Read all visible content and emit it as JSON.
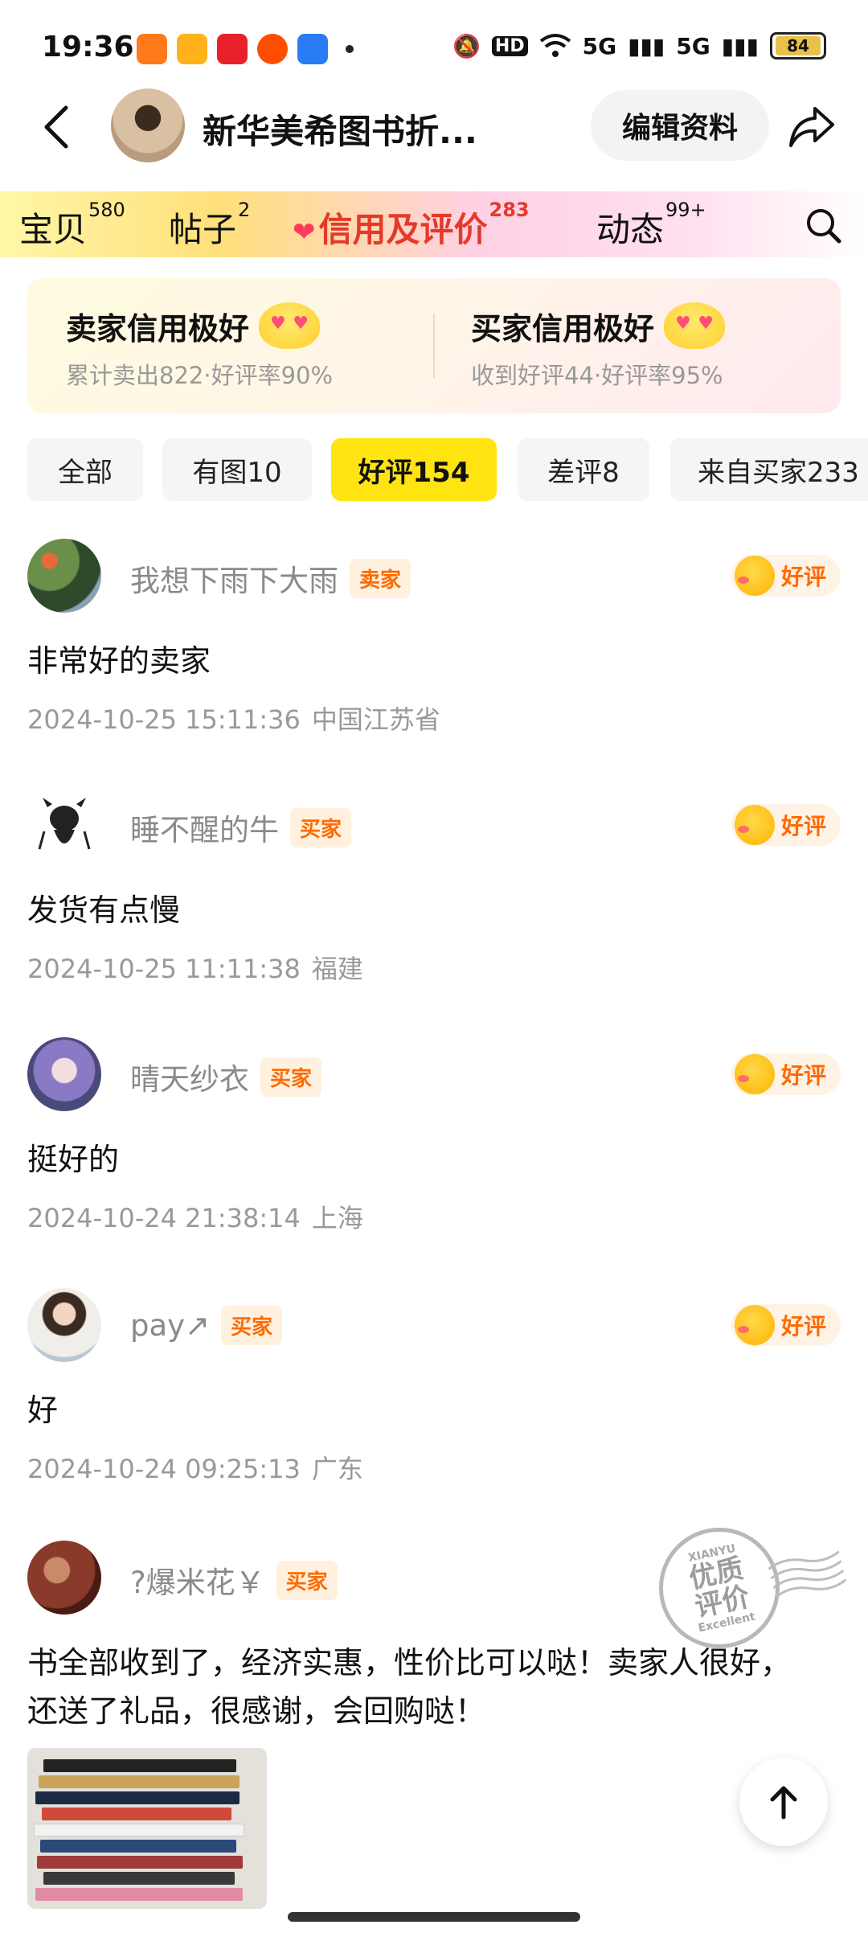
{
  "status_bar": {
    "time": "19:36",
    "battery": "84",
    "network": "5G"
  },
  "header": {
    "shop_name": "新华美希图书折...",
    "edit_button": "编辑资料"
  },
  "tabs": [
    {
      "label": "宝贝",
      "count": "580",
      "active": false
    },
    {
      "label": "帖子",
      "count": "2",
      "active": false
    },
    {
      "label": "信用及评价",
      "count": "283",
      "active": true
    },
    {
      "label": "动态",
      "count": "99+",
      "active": false
    }
  ],
  "credit": {
    "seller": {
      "title": "卖家信用极好",
      "sub": "累计卖出822·好评率90%"
    },
    "buyer": {
      "title": "买家信用极好",
      "sub": "收到好评44·好评率95%"
    }
  },
  "filters": [
    {
      "label": "全部",
      "active": false
    },
    {
      "label": "有图10",
      "active": false
    },
    {
      "label": "好评154",
      "active": true
    },
    {
      "label": "差评8",
      "active": false
    },
    {
      "label": "来自买家233",
      "active": false
    }
  ],
  "reviews": [
    {
      "user": "我想下雨下大雨",
      "role": "卖家",
      "rating": "好评",
      "text": "非常好的卖家",
      "time": "2024-10-25 15:11:36",
      "location": "中国江苏省"
    },
    {
      "user": "睡不醒的牛",
      "role": "买家",
      "rating": "好评",
      "text": "发货有点慢",
      "time": "2024-10-25 11:11:38",
      "location": "福建"
    },
    {
      "user": "晴天纱衣",
      "role": "买家",
      "rating": "好评",
      "text": "挺好的",
      "time": "2024-10-24 21:38:14",
      "location": "上海"
    },
    {
      "user": "pay↗",
      "role": "买家",
      "rating": "好评",
      "text": "好",
      "time": "2024-10-24 09:25:13",
      "location": "广东"
    },
    {
      "user": "?爆米花￥",
      "role": "买家",
      "rating": "",
      "text_line1": "书全部收到了，经济实惠，性价比可以哒！卖家人很好，",
      "text_line2": "还送了礼品，很感谢，会回购哒！"
    }
  ],
  "stamp": {
    "top": "XIANYU",
    "line1": "优质",
    "line2": "评价",
    "bottom": "Excellent"
  }
}
